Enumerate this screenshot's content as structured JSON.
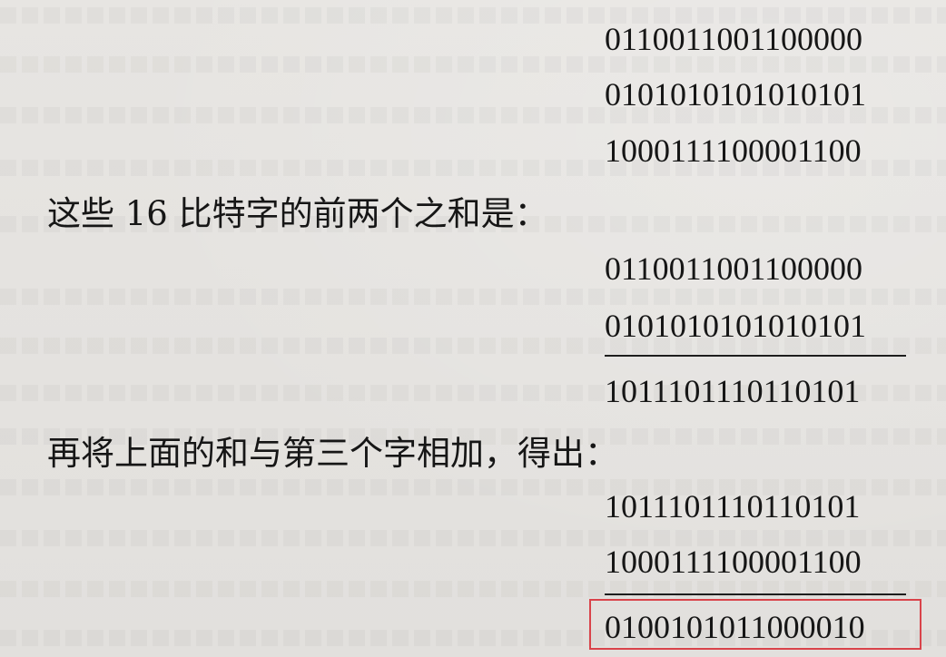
{
  "block1": {
    "line1": "0110011001100000",
    "line2": "0101010101010101",
    "line3": "1000111100001100"
  },
  "text1": "这些 16 比特字的前两个之和是：",
  "sum1": {
    "line1": "0110011001100000",
    "line2": "0101010101010101",
    "result": "1011101110110101"
  },
  "text2": "再将上面的和与第三个字相加，得出：",
  "sum2": {
    "line1": "1011101110110101",
    "line2": "1000111100001100",
    "result": "0100101011000010"
  },
  "colors": {
    "highlight": "#d9434a",
    "text": "#161616",
    "paper": "#e4e2df"
  }
}
